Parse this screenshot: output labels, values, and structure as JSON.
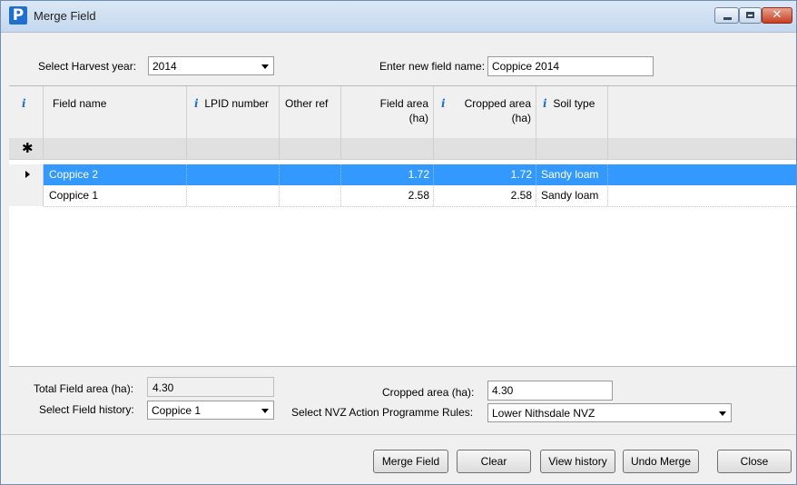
{
  "window": {
    "title": "Merge Field",
    "icon_letter": "P",
    "close_glyph": "✕"
  },
  "harvest": {
    "label": "Select Harvest year:",
    "value": "2014"
  },
  "new_name": {
    "label": "Enter new field name:",
    "value": "Coppice 2014"
  },
  "grid": {
    "columns": {
      "field_name": "Field name",
      "lpid": "LPID number",
      "other_ref": "Other ref",
      "field_area_1": "Field area",
      "field_area_2": "(ha)",
      "cropped_area_1": "Cropped area",
      "cropped_area_2": "(ha)",
      "soil_type": "Soil type"
    },
    "new_row_glyph": "✱",
    "rows": [
      {
        "field_name": "Coppice 2",
        "lpid": "",
        "other_ref": "",
        "field_area": "1.72",
        "cropped_area": "1.72",
        "soil_type": "Sandy loam",
        "selected": true
      },
      {
        "field_name": "Coppice 1",
        "lpid": "",
        "other_ref": "",
        "field_area": "2.58",
        "cropped_area": "2.58",
        "soil_type": "Sandy loam",
        "selected": false
      }
    ]
  },
  "totals": {
    "total_label": "Total Field area (ha):",
    "total_value": "4.30",
    "cropped_label": "Cropped area (ha):",
    "cropped_value": "4.30"
  },
  "history": {
    "label": "Select Field history:",
    "value": "Coppice 1"
  },
  "nvz": {
    "label": "Select NVZ Action Programme Rules:",
    "value": "Lower Nithsdale NVZ"
  },
  "buttons": {
    "merge": "Merge Field",
    "clear": "Clear",
    "view_history": "View history",
    "undo_merge": "Undo Merge",
    "close": "Close"
  },
  "colors": {
    "selection": "#3399ff",
    "accent": "#1f6fd0"
  }
}
